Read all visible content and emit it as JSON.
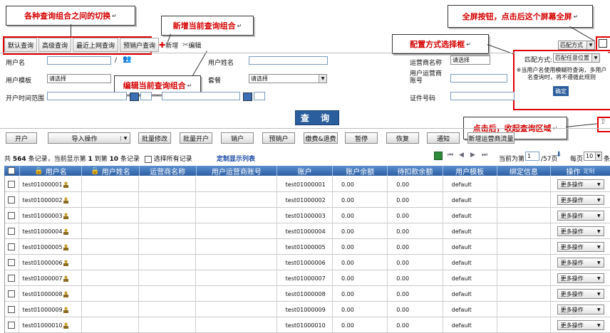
{
  "callouts": {
    "switch": "各种查询组合之间的切换",
    "add": "新增当前查询组合",
    "edit": "编辑当前查询组合",
    "fullscreen": "全屏按钮，点击后这个屏幕全屏",
    "config": "配置方式选择框",
    "collapse": "点击后，收起查询区域"
  },
  "tabs": [
    "默认查询",
    "高级查询",
    "最近上网查询",
    "预销户查询"
  ],
  "toolbar": {
    "add": "新增",
    "edit": "编辑",
    "match_mode": "匹配方式"
  },
  "form": {
    "username": "用户名",
    "realname": "用户姓名",
    "operator_name": "运营商名称",
    "operator_placeholder": "请选择",
    "user_template": "用户模板",
    "template_placeholder": "请选择",
    "package_partial": "套餐",
    "package_placeholder": "请选择",
    "operator_account": "用户运营商账号",
    "open_time_range": "开户时间范围",
    "id_number": "证件号码",
    "query": "查 询"
  },
  "match_popup": {
    "label": "匹配方式:",
    "selected": "匹配任意位置",
    "note": "※当用户名使用模糊符查询，多用户名查询时，将不遵循此规则",
    "confirm": "确定"
  },
  "actions": [
    "开户",
    "导入操作",
    "批量修改",
    "批量开户",
    "销户",
    "预销户",
    "缴费&退费",
    "暂停",
    "恢复",
    "通知",
    "新增运营商流量"
  ],
  "summary": {
    "prefix": "共",
    "total": "564",
    "mid1": "条记录，当前显示第",
    "from": "1",
    "mid2": "到第",
    "to": "10",
    "mid3": "条记录",
    "select_all": "选择所有记录",
    "custom_list": "定制显示列表"
  },
  "pager": {
    "current_label": "当前为第",
    "page": "1",
    "total": "/57页",
    "per_page_label": "每页",
    "per_page": "10",
    "unit": "条"
  },
  "columns": [
    "用户名",
    "用户姓名",
    "运营商名称",
    "用户运营商账号",
    "账户",
    "账户余额",
    "待扣款余额",
    "用户模板",
    "绑定信息",
    "操作"
  ],
  "custom": "定制",
  "rows": [
    {
      "user": "test01000001",
      "account": "test01000001",
      "balance": "0.00",
      "pending": "0.00",
      "template": "default"
    },
    {
      "user": "test01000002",
      "account": "test01000002",
      "balance": "0.00",
      "pending": "0.00",
      "template": "default"
    },
    {
      "user": "test01000003",
      "account": "test01000003",
      "balance": "0.00",
      "pending": "0.00",
      "template": "default"
    },
    {
      "user": "test01000004",
      "account": "test01000004",
      "balance": "0.00",
      "pending": "0.00",
      "template": "default"
    },
    {
      "user": "test01000005",
      "account": "test01000005",
      "balance": "0.00",
      "pending": "0.00",
      "template": "default"
    },
    {
      "user": "test01000006",
      "account": "test01000006",
      "balance": "0.00",
      "pending": "0.00",
      "template": "default"
    },
    {
      "user": "test01000007",
      "account": "test01000007",
      "balance": "0.00",
      "pending": "0.00",
      "template": "default"
    },
    {
      "user": "test01000008",
      "account": "test01000008",
      "balance": "0.00",
      "pending": "0.00",
      "template": "default"
    },
    {
      "user": "test01000009",
      "account": "test01000009",
      "balance": "0.00",
      "pending": "0.00",
      "template": "default"
    },
    {
      "user": "test01000010",
      "account": "test01000010",
      "balance": "0.00",
      "pending": "0.00",
      "template": "default"
    }
  ],
  "more_ops": "更多操作"
}
